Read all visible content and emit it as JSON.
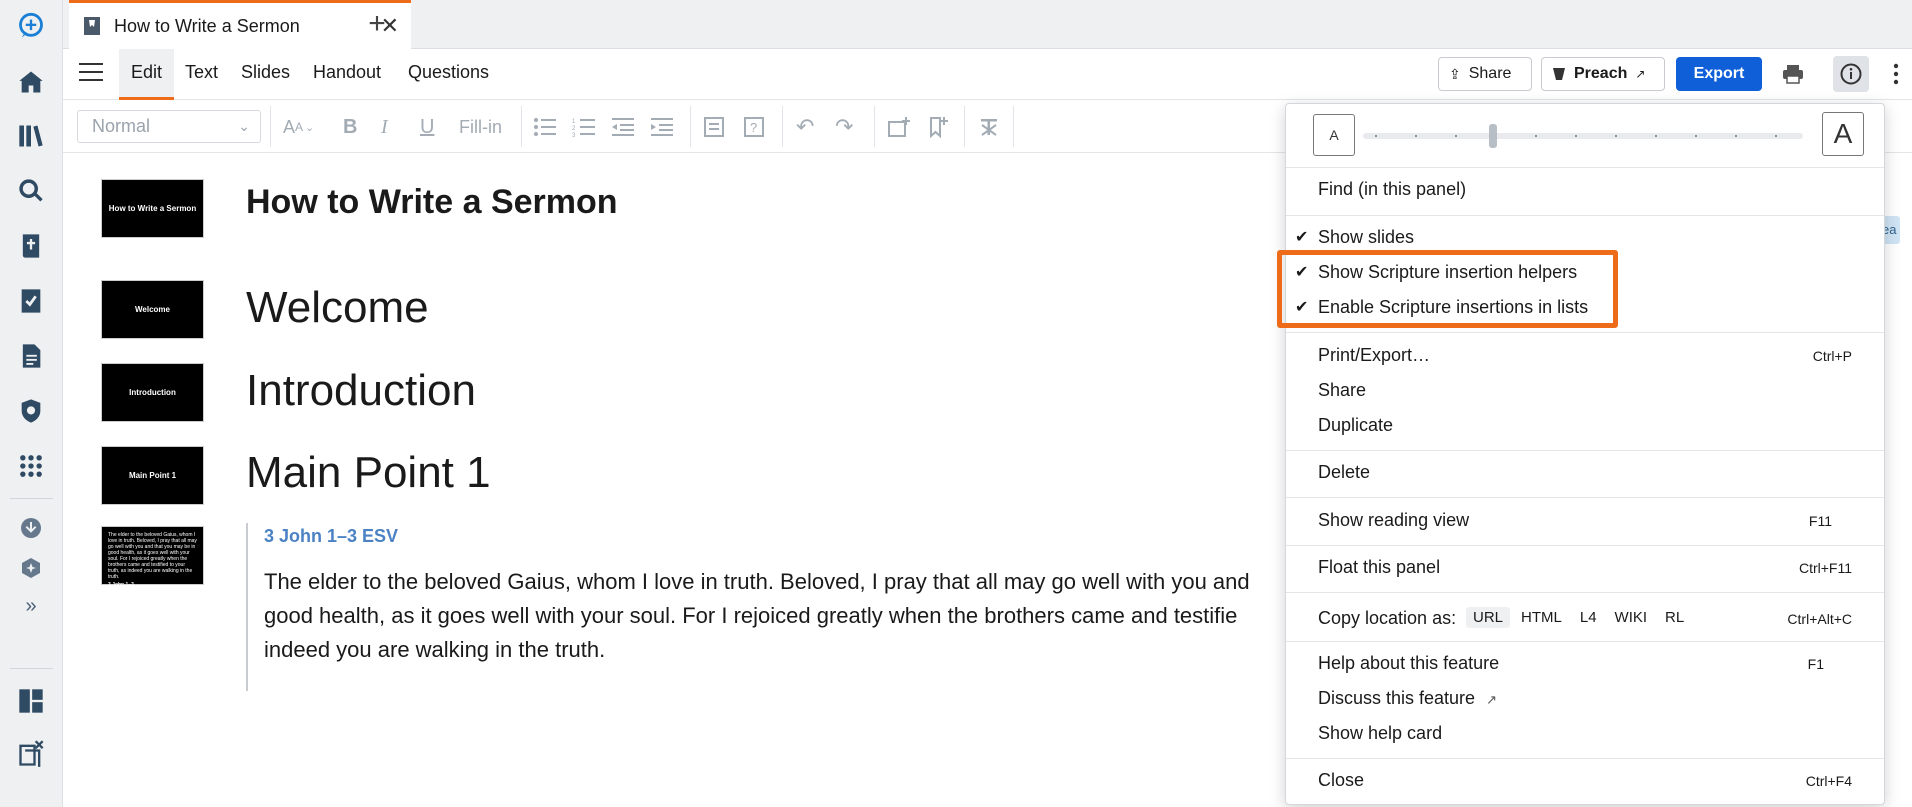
{
  "tab": {
    "title": "How to Write a Sermon",
    "close": "✕",
    "new": "+"
  },
  "menubar": {
    "items": [
      "Edit",
      "Text",
      "Slides",
      "Handout",
      "Questions"
    ],
    "share": "Share",
    "preach": "Preach",
    "export": "Export"
  },
  "toolbar": {
    "style_select": "Normal",
    "fill_in": "Fill-in"
  },
  "document": {
    "title": "How to Write a Sermon",
    "headings": [
      "Welcome",
      "Introduction",
      "Main Point 1"
    ],
    "slides": [
      "How to Write a Sermon",
      "Welcome",
      "Introduction",
      "Main Point 1"
    ],
    "scripture_ref": "3 John 1–3 ESV",
    "scripture_text_lines": [
      "The elder to the beloved Gaius, whom I love in truth. Beloved, I pray that all may go well with you and",
      "good health, as it goes well with your soul. For I rejoiced greatly when the brothers came and testifie",
      "indeed you are walking in the truth."
    ],
    "scripture_slide_text": "The elder to the beloved Gaius, whom I love in truth. Beloved, I pray that all may go well with you and that you may be in good health, as it goes well with your soul. For I rejoiced greatly when the brothers came and testified to your truth, as indeed you are walking in the truth.",
    "scripture_slide_ref": "3 John 1–3",
    "side_tag": "ea"
  },
  "panel_menu": {
    "font_small": "A",
    "font_large": "A",
    "find": "Find (in this panel)",
    "show_slides": "Show slides",
    "show_scripture_helpers": "Show Scripture insertion helpers",
    "enable_scripture_lists": "Enable Scripture insertions in lists",
    "print_export": "Print/Export…",
    "print_export_key": "Ctrl+P",
    "share": "Share",
    "duplicate": "Duplicate",
    "delete": "Delete",
    "reading_view": "Show reading view",
    "reading_view_key": "F11",
    "float_panel": "Float this panel",
    "float_panel_key": "Ctrl+F11",
    "copy_location": "Copy location as:",
    "copy_options": [
      "URL",
      "HTML",
      "L4",
      "WIKI",
      "RL"
    ],
    "copy_location_key": "Ctrl+Alt+C",
    "help_feature": "Help about this feature",
    "help_feature_key": "F1",
    "discuss_feature": "Discuss this feature",
    "help_card": "Show help card",
    "close": "Close",
    "close_key": "Ctrl+F4",
    "check": "✔"
  },
  "colors": {
    "accent": "#ee6b19",
    "primary": "#0f5fd8",
    "scripture_ref": "#4b82c4"
  }
}
